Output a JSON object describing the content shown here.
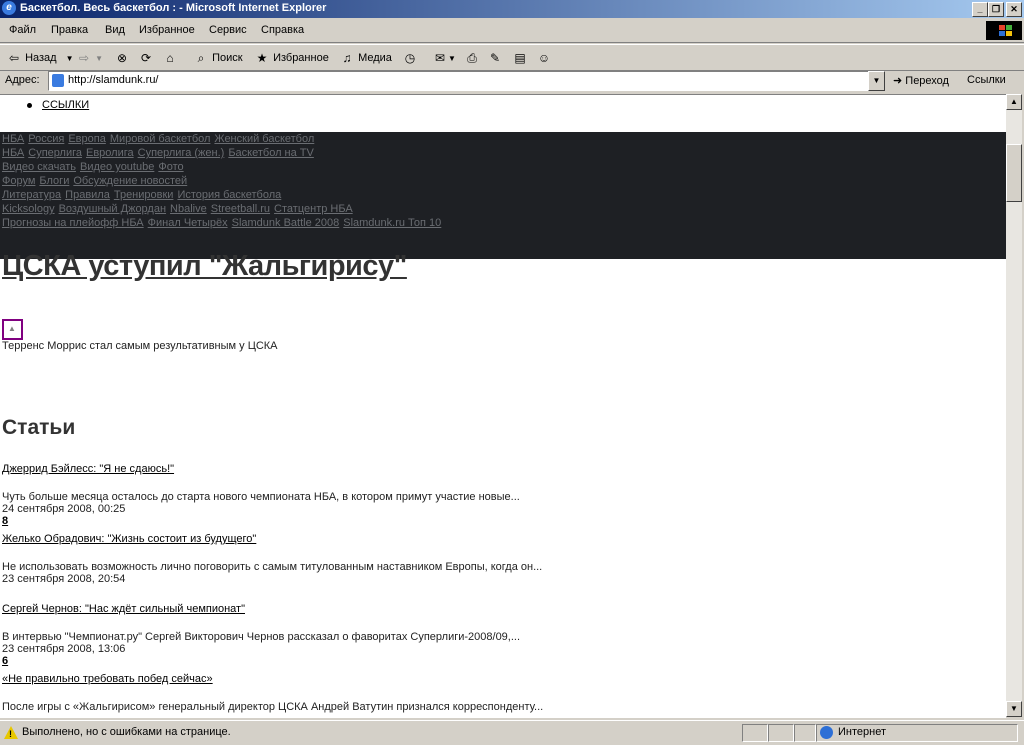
{
  "window": {
    "title": "Баскетбол. Весь баскетбол : - Microsoft Internet Explorer"
  },
  "menu": {
    "items": [
      "Файл",
      "Правка",
      "Вид",
      "Избранное",
      "Сервис",
      "Справка"
    ]
  },
  "toolbar": {
    "back_label": "Назад",
    "search_label": "Поиск",
    "favorites_label": "Избранное",
    "media_label": "Медиа"
  },
  "address": {
    "label": "Адрес:",
    "url": "http://slamdunk.ru/",
    "go_label": "Переход",
    "links_label": "Ссылки"
  },
  "page": {
    "top_link": "ССЫЛКИ",
    "nav_rows": [
      [
        "НБА",
        "Россия",
        "Европа",
        "Мировой баскетбол",
        "Женский баскетбол"
      ],
      [
        "НБА",
        "Суперлига",
        "Евролига",
        "Суперлига (жен.)",
        "Баскетбол на TV"
      ],
      [
        "Видео скачать",
        "Видео youtube",
        "Фото"
      ],
      [
        "Форум",
        "Блоги",
        "Обсуждение новостей"
      ],
      [
        "Литература",
        "Правила",
        "Тренировки",
        "История баскетбола"
      ],
      [
        "Kicksology",
        "Воздушный Джордан",
        "Nbalive",
        "Streetball.ru",
        "Статцентр НБА"
      ],
      [
        "Прогнозы на плейофф НБА",
        "Финал Четырёх",
        "Slamdunk Battle 2008",
        "Slamdunk.ru Топ 10"
      ]
    ],
    "headline": "ЦСКА уступил \"Жальгирису\"",
    "caption": "Терренс Моррис стал самым результативным у ЦСКА",
    "section_title": "Статьи",
    "articles": [
      {
        "title": "Джеррид Бэйлесс: \"Я не сдаюсь!\"",
        "desc": "Чуть больше месяца осталось до старта нового чемпионата НБА, в котором примут участие новые...",
        "date": "24 сентября 2008, 00:25",
        "num": "8"
      },
      {
        "title": "Желько Обрадович: \"Жизнь состоит из будущего\"",
        "desc": "Не использовать возможность лично поговорить с самым титулованным наставником Европы, когда он...",
        "date": "23 сентября 2008, 20:54",
        "num": ""
      },
      {
        "title": "Сергей Чернов: \"Нас ждёт сильный чемпионат\"",
        "desc": "В интервью \"Чемпионат.ру\" Сергей Викторович Чернов рассказал о фаворитах Суперлиги-2008/09,...",
        "date": "23 сентября 2008, 13:06",
        "num": "6"
      },
      {
        "title": "«Не правильно требовать побед сейчас»",
        "desc": "После игры с «Жальгирисом» генеральный директор ЦСКА Андрей Ватутин признался корреспонденту...",
        "date": "",
        "num": ""
      }
    ]
  },
  "status": {
    "text": "Выполнено, но с ошибками на странице.",
    "zone": "Интернет"
  }
}
